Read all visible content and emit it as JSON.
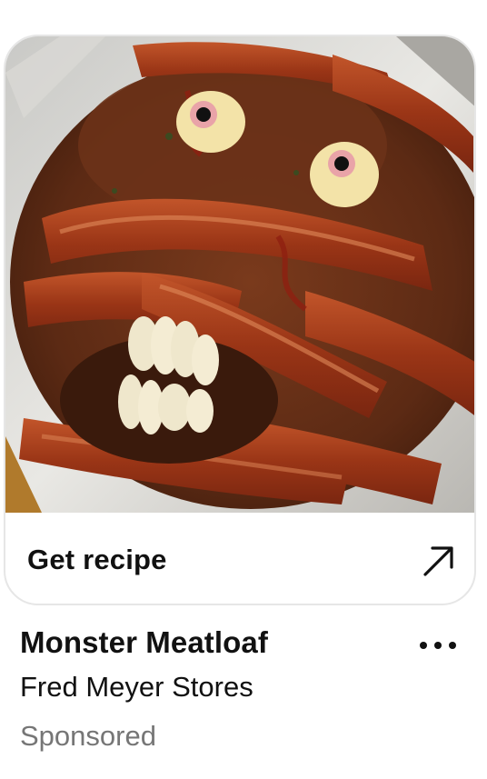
{
  "pin": {
    "image_alt": "Bacon-wrapped monster meatloaf with egg eyes and garlic teeth",
    "cta_label": "Get recipe",
    "cta_icon": "arrow-up-right-icon",
    "title": "Monster Meatloaf",
    "advertiser": "Fred Meyer Stores",
    "sponsored_label": "Sponsored",
    "more_icon": "more-options-icon"
  },
  "colors": {
    "text_primary": "#111111",
    "text_secondary": "#767676",
    "card_border": "#e6e6e6"
  }
}
